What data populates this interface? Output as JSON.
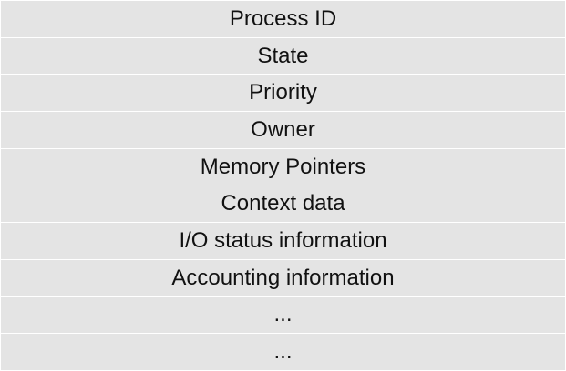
{
  "pcb": {
    "rows": [
      "Process ID",
      "State",
      "Priority",
      "Owner",
      "Memory Pointers",
      "Context data",
      "I/O status information",
      "Accounting information",
      "...",
      "..."
    ]
  }
}
